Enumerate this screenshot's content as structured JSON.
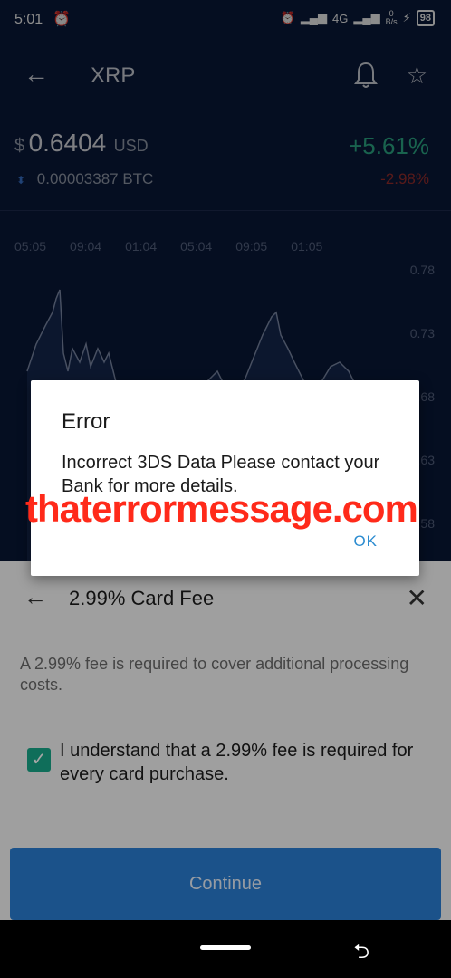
{
  "status_bar": {
    "time": "5:01",
    "network": "4G",
    "speed_top": "0",
    "speed_bottom": "B/s",
    "battery": "98"
  },
  "app_bar": {
    "title": "XRP"
  },
  "price": {
    "currency_symbol": "$",
    "value": "0.6404",
    "unit": "USD",
    "change": "+5.61%",
    "btc_value": "0.00003387 BTC",
    "btc_change": "-2.98%"
  },
  "chart": {
    "time_labels": [
      "05:05",
      "09:04",
      "01:04",
      "05:04",
      "09:05",
      "01:05"
    ],
    "price_labels": [
      "0.78",
      "0.73",
      "0.68",
      "0.63",
      "0.58"
    ]
  },
  "sheet": {
    "title": "2.99% Card Fee",
    "description": "A 2.99% fee is required to cover additional processing costs.",
    "checkbox_checked": true,
    "checkbox_label": "I understand that a 2.99% fee is required for every card purchase.",
    "continue_label": "Continue"
  },
  "dialog": {
    "title": "Error",
    "message": "Incorrect 3DS Data Please contact your Bank for more details.",
    "ok_label": "OK"
  },
  "watermark": "thaterrormessage.com",
  "colors": {
    "accent_green": "#2fb58f",
    "accent_blue": "#2a7fd4",
    "negative_red": "#a03030",
    "watermark_red": "#ff2a1a"
  }
}
